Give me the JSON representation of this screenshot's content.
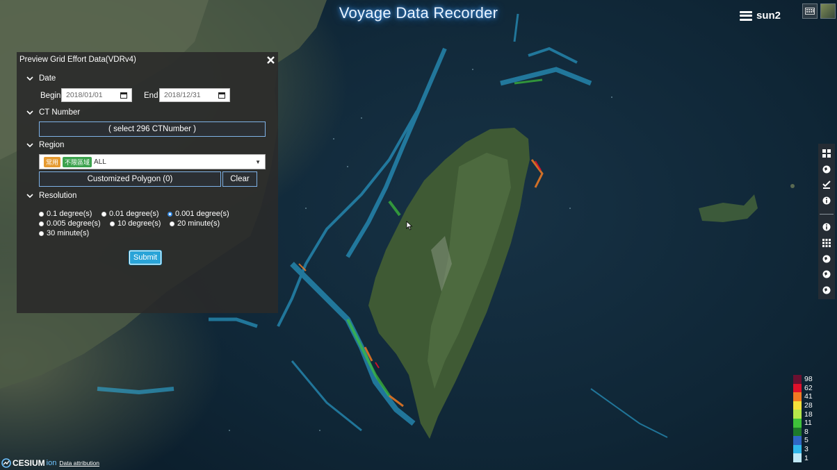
{
  "app": {
    "title": "Voyage Data Recorder",
    "user": "sun2"
  },
  "panel": {
    "title": "Preview Grid Effort Data(VDRv4)",
    "sections": {
      "date": "Date",
      "ct": "CT Number",
      "region": "Region",
      "resolution": "Resolution"
    },
    "begin_label": "Begin",
    "end_label": "End",
    "begin_value": "2018/01/01",
    "end_value": "2018/12/31",
    "ct_button": "( select 296 CTNumber )",
    "region_tags": [
      "常用",
      "不限區域"
    ],
    "region_value": "ALL",
    "polygon_button": "Customized Polygon (0)",
    "clear_button": "Clear",
    "resolution_options": [
      "0.1 degree(s)",
      "0.01 degree(s)",
      "0.001 degree(s)",
      "0.005 degree(s)",
      "10 degree(s)",
      "20 minute(s)",
      "30 minute(s)"
    ],
    "resolution_selected": "0.001 degree(s)",
    "submit": "Submit"
  },
  "legend": [
    {
      "label": "98",
      "color": "#6b1030"
    },
    {
      "label": "62",
      "color": "#e0102a"
    },
    {
      "label": "41",
      "color": "#f07a22"
    },
    {
      "label": "28",
      "color": "#f4e03a"
    },
    {
      "label": "18",
      "color": "#b6e84a"
    },
    {
      "label": "11",
      "color": "#3fc23a"
    },
    {
      "label": "8",
      "color": "#1e7a2a"
    },
    {
      "label": "5",
      "color": "#2f66c4"
    },
    {
      "label": "3",
      "color": "#2fb6ea"
    },
    {
      "label": "1",
      "color": "#bfe8f6"
    }
  ],
  "footer": {
    "brand": "CESIUM",
    "brand_suffix": "ion",
    "attribution": "Data attribution"
  },
  "icons": {
    "toolbar": [
      "grid-view-icon",
      "globe-icon",
      "checklist-icon",
      "info-icon",
      "info-icon",
      "grid-icon",
      "globe-icon",
      "globe-icon",
      "globe-icon"
    ]
  }
}
